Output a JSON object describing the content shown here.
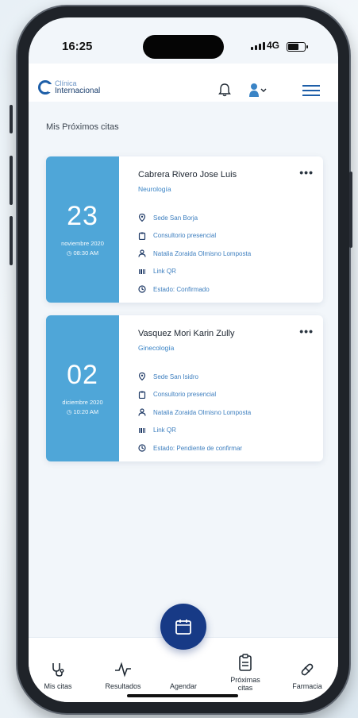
{
  "status": {
    "time": "16:25",
    "network": "4G"
  },
  "header": {
    "logo_line1": "Clínica",
    "logo_line2": "Internacional"
  },
  "section_title": "Mis Próximos citas",
  "appointments": [
    {
      "day": "23",
      "month": "noviembre 2020",
      "hour": "08:30 AM",
      "doctor": "Cabrera Rivero Jose Luis",
      "specialty": "Neurología",
      "location": "Sede San Borja",
      "type": "Consultorio presencial",
      "patient": "Natalia Zoraida Olmisno Lomposta",
      "qr": "Link QR",
      "status": "Estado: Confirmado"
    },
    {
      "day": "02",
      "month": "diciembre 2020",
      "hour": "10:20 AM",
      "doctor": "Vasquez Mori Karin Zully",
      "specialty": "Ginecología",
      "location": "Sede San Isidro",
      "type": "Consultorio presencial",
      "patient": "Natalia Zoraida Olmisno Lomposta",
      "qr": "Link QR",
      "status": "Estado: Pendiente de confirmar"
    }
  ],
  "nav": {
    "mis_citas": "Mis citas",
    "resultados": "Resultados",
    "agendar": "Agendar",
    "proximas_1": "Próximas",
    "proximas_2": "citas",
    "farmacia": "Farmacia"
  },
  "colors": {
    "accent": "#4fa6d8",
    "primary": "#173a86",
    "link": "#3e7fbf"
  }
}
